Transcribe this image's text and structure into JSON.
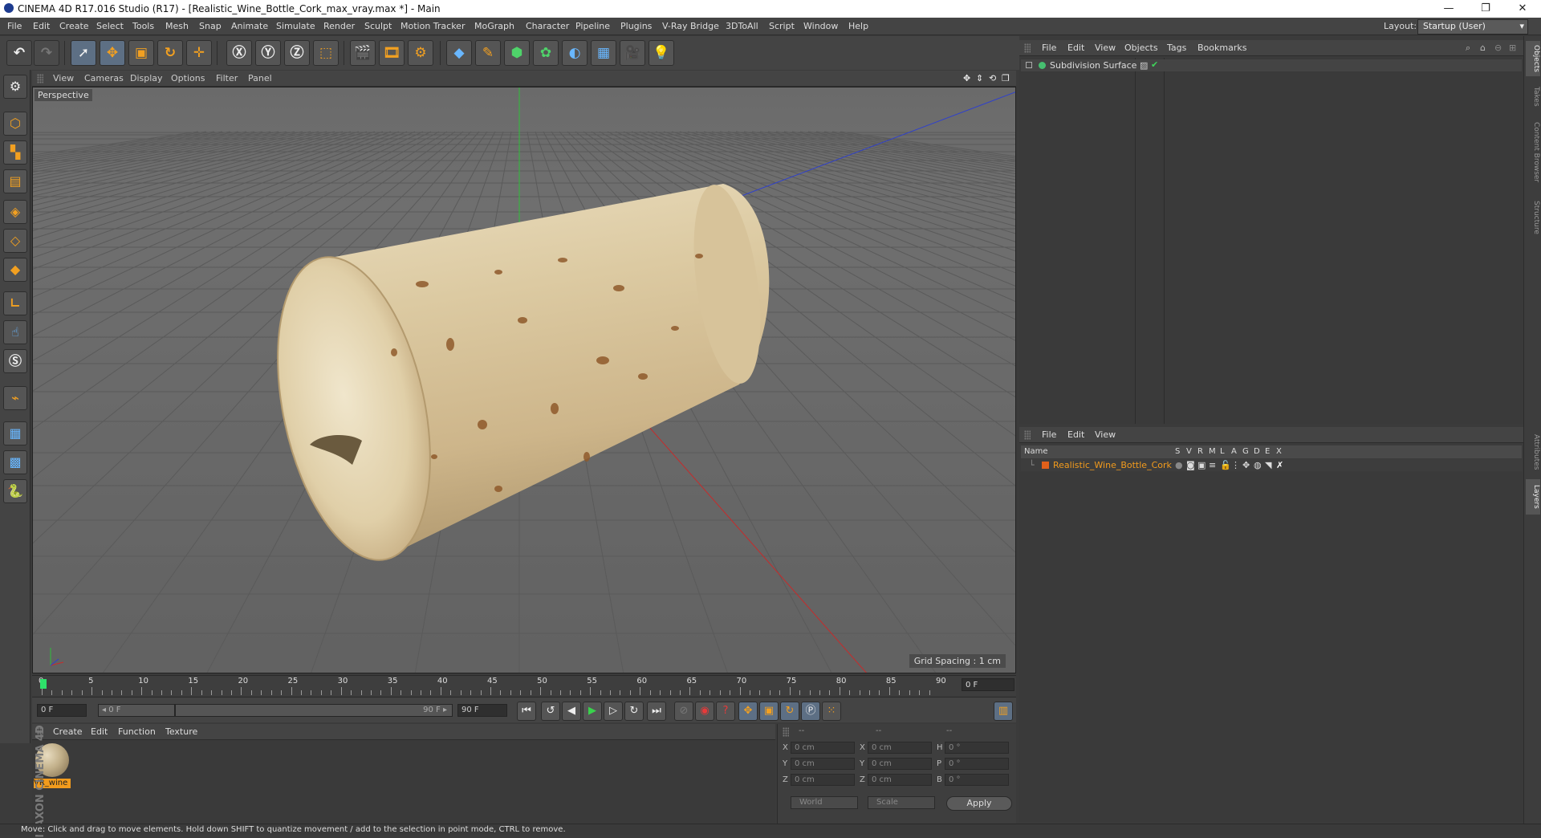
{
  "window": {
    "title": "CINEMA 4D R17.016 Studio (R17) - [Realistic_Wine_Bottle_Cork_max_vray.max *] - Main",
    "minimize": "—",
    "maximize": "❐",
    "close": "✕"
  },
  "menu": [
    "File",
    "Edit",
    "Create",
    "Select",
    "Tools",
    "Mesh",
    "Snap",
    "Animate",
    "Simulate",
    "Render",
    "Sculpt",
    "Motion Tracker",
    "MoGraph",
    "Character",
    "Pipeline",
    "Plugins",
    "V-Ray Bridge",
    "3DToAll",
    "Script",
    "Window",
    "Help"
  ],
  "layout": {
    "label": "Layout:",
    "value": "Startup (User)"
  },
  "toolbar_icons": [
    "undo-icon",
    "redo-icon",
    "select-icon",
    "move-icon",
    "scale-icon",
    "rotate-icon",
    "last-tool-icon",
    "x-axis-icon",
    "y-axis-icon",
    "z-axis-icon",
    "coordinate-system-icon",
    "render-view-icon",
    "render-picture-viewer-icon",
    "render-settings-icon",
    "cube-icon",
    "pen-spline-icon",
    "subdivision-icon",
    "mograph-cloner-icon",
    "deformer-icon",
    "floor-icon",
    "camera-icon",
    "light-icon"
  ],
  "viewport": {
    "menu": [
      "View",
      "Cameras",
      "Display",
      "Options",
      "Filter",
      "Panel"
    ],
    "label": "Perspective",
    "grid_spacing": "Grid Spacing : 1 cm"
  },
  "timeline": {
    "ticks": [
      "0",
      "5",
      "10",
      "15",
      "20",
      "25",
      "30",
      "35",
      "40",
      "45",
      "50",
      "55",
      "60",
      "65",
      "70",
      "75",
      "80",
      "85",
      "90"
    ],
    "current_frame": "0 F",
    "start": "0 F",
    "range_start": "◂ 0 F",
    "range_end": "90 F ▸",
    "end": "90 F"
  },
  "materials": {
    "menu": [
      "Create",
      "Edit",
      "Function",
      "Texture"
    ],
    "items": [
      {
        "name": "VR_wine"
      }
    ]
  },
  "coordinates": {
    "headers": [
      "--",
      "--",
      "--"
    ],
    "rows": [
      {
        "a1": "X",
        "v1": "0 cm",
        "a2": "X",
        "v2": "0 cm",
        "a3": "H",
        "v3": "0 °"
      },
      {
        "a1": "Y",
        "v1": "0 cm",
        "a2": "Y",
        "v2": "0 cm",
        "a3": "P",
        "v3": "0 °"
      },
      {
        "a1": "Z",
        "v1": "0 cm",
        "a2": "Z",
        "v2": "0 cm",
        "a3": "B",
        "v3": "0 °"
      }
    ],
    "mode_world": "World",
    "mode_scale": "Scale",
    "apply": "Apply"
  },
  "objects": {
    "menu": [
      "File",
      "Edit",
      "View",
      "Objects",
      "Tags",
      "Bookmarks"
    ],
    "items": [
      {
        "name": "Subdivision Surface"
      }
    ]
  },
  "layers": {
    "menu": [
      "File",
      "Edit",
      "View"
    ],
    "columns": [
      "Name",
      "S",
      "V",
      "R",
      "M",
      "L",
      "A",
      "G",
      "D",
      "E",
      "X"
    ],
    "items": [
      {
        "name": "Realistic_Wine_Bottle_Cork"
      }
    ]
  },
  "side_tabs": [
    "Objects",
    "Takes",
    "Content Browser",
    "Structure",
    "Attributes",
    "Layers"
  ],
  "brand": "MAXON CINEMA 4D",
  "status": "Move: Click and drag to move elements. Hold down SHIFT to quantize movement / add to the selection in point mode, CTRL to remove."
}
